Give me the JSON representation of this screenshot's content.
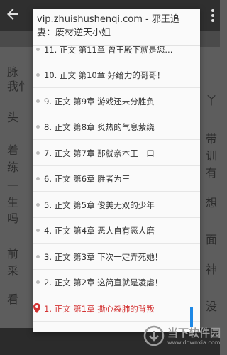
{
  "background": {
    "text_lines": [
      {
        "text": "脉",
        "top": 0
      },
      {
        "text": "我忄",
        "top": 0
      },
      {
        "text": "头",
        "top": 0
      },
      {
        "text": "着",
        "top": 0
      },
      {
        "text": "练",
        "top": 0
      },
      {
        "text": "一",
        "top": 0
      },
      {
        "text": "生",
        "top": 0
      },
      {
        "text": "吗",
        "top": 0
      },
      {
        "text": "前",
        "top": 0
      },
      {
        "text": "采",
        "top": 0
      },
      {
        "text": "看",
        "top": 0
      }
    ],
    "right_text": [
      "丫",
      "带",
      "训",
      "有",
      "想",
      "面",
      "神",
      "没"
    ]
  },
  "dialog": {
    "title": "vip.zhuishushenqi.com - 邪王追妻：废材逆天小姐",
    "partial_top_item": "11. 正文 第11章 曾王殿下就是您...",
    "chapters": [
      {
        "label": "10. 正文 第10章 好给力的哥哥！",
        "current": false
      },
      {
        "label": "9. 正文 第9章 游戏还未分胜负",
        "current": false
      },
      {
        "label": "8. 正文 第8章 炙热的气息萦绕",
        "current": false
      },
      {
        "label": "7. 正文 第7章 那就亲本王一口",
        "current": false
      },
      {
        "label": "6. 正文 第6章 胜者为王",
        "current": false
      },
      {
        "label": "5. 正文 第5章 俊美无双的少年",
        "current": false
      },
      {
        "label": "4. 正文 第4章 恶人自有恶人磨",
        "current": false
      },
      {
        "label": "3. 正文 第3章 下次一定弄死她！",
        "current": false
      },
      {
        "label": "2. 正文 第2章 这简直就是凌虐！",
        "current": false
      },
      {
        "label": "1. 正文 第1章 撕心裂肺的背叛",
        "current": true
      }
    ],
    "accent_color": "#d33333",
    "scrollbar_color": "#1e88e5"
  },
  "watermark": {
    "text": "当下软件园",
    "url": "www.downxia.com"
  }
}
